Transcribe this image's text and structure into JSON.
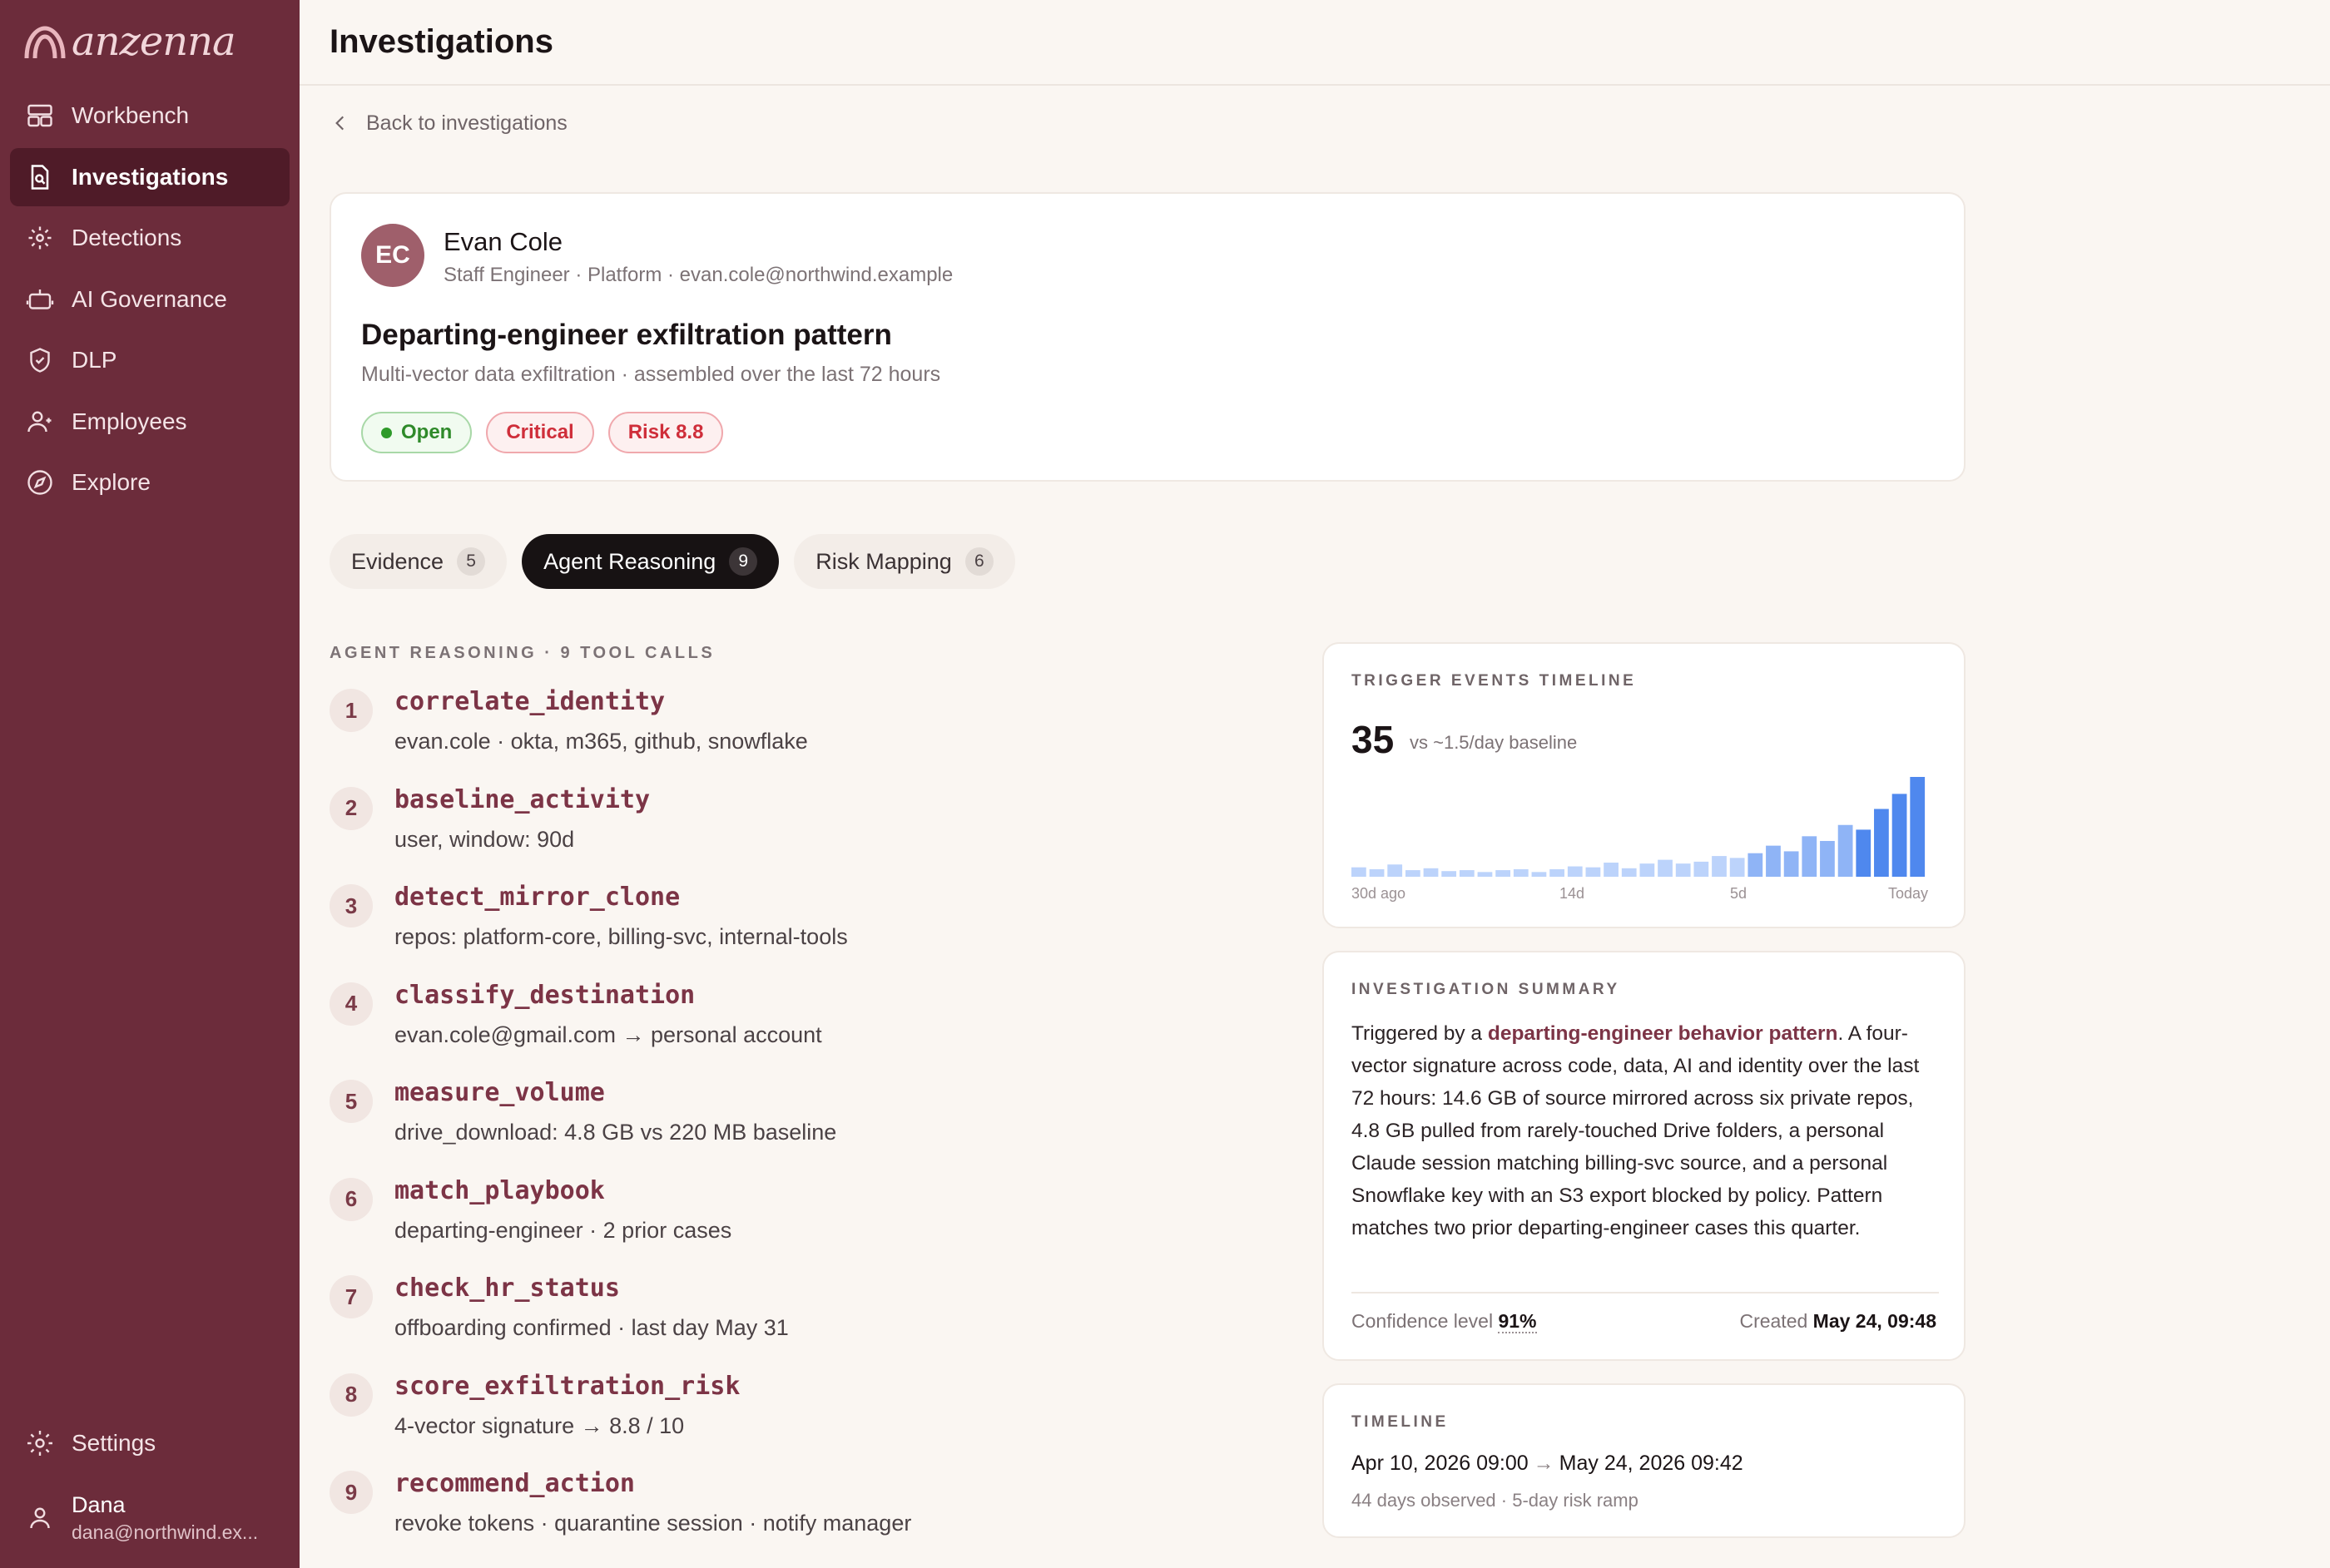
{
  "app": {
    "name": "anzenna"
  },
  "sidebar": {
    "items": [
      {
        "label": "Workbench",
        "icon": "layout-icon",
        "active": false
      },
      {
        "label": "Investigations",
        "icon": "file-search-icon",
        "active": true
      },
      {
        "label": "Detections",
        "icon": "radar-icon",
        "active": false
      },
      {
        "label": "AI Governance",
        "icon": "robot-icon",
        "active": false
      },
      {
        "label": "DLP",
        "icon": "shield-icon",
        "active": false
      },
      {
        "label": "Employees",
        "icon": "user-icon",
        "active": false
      },
      {
        "label": "Explore",
        "icon": "compass-icon",
        "active": false
      }
    ],
    "settings_label": "Settings",
    "user": {
      "name": "Dana",
      "email": "dana@northwind.ex..."
    }
  },
  "header": {
    "title": "Investigations"
  },
  "back_link": "Back to investigations",
  "case": {
    "avatar_initials": "EC",
    "person_name": "Evan Cole",
    "person_meta": "Staff Engineer · Platform · evan.cole@northwind.example",
    "title": "Departing-engineer exfiltration pattern",
    "subtitle": "Multi-vector data exfiltration · assembled over the last 72 hours",
    "badges": {
      "status": "Open",
      "severity": "Critical",
      "risk": "Risk 8.8"
    }
  },
  "tabs": [
    {
      "label": "Evidence",
      "count": "5",
      "active": false
    },
    {
      "label": "Agent Reasoning",
      "count": "9",
      "active": true
    },
    {
      "label": "Risk Mapping",
      "count": "6",
      "active": false
    }
  ],
  "reasoning": {
    "label": "AGENT REASONING · 9 TOOL CALLS",
    "steps": [
      {
        "num": "1",
        "name": "correlate_identity",
        "args": "evan.cole · okta, m365, github, snowflake"
      },
      {
        "num": "2",
        "name": "baseline_activity",
        "args": "user, window: 90d"
      },
      {
        "num": "3",
        "name": "detect_mirror_clone",
        "args": "repos: platform-core, billing-svc, internal-tools"
      },
      {
        "num": "4",
        "name": "classify_destination",
        "args": "evan.cole@gmail.com → personal account"
      },
      {
        "num": "5",
        "name": "measure_volume",
        "args": "drive_download: 4.8 GB vs 220 MB baseline"
      },
      {
        "num": "6",
        "name": "match_playbook",
        "args": "departing-engineer · 2 prior cases"
      },
      {
        "num": "7",
        "name": "check_hr_status",
        "args": "offboarding confirmed · last day May 31"
      },
      {
        "num": "8",
        "name": "score_exfiltration_risk",
        "args": "4-vector signature → 8.8 / 10"
      },
      {
        "num": "9",
        "name": "recommend_action",
        "args": "revoke tokens · quarantine session · notify manager"
      }
    ]
  },
  "trigger": {
    "label": "TRIGGER EVENTS TIMELINE",
    "count": "35",
    "baseline": "vs ~1.5/day baseline",
    "axis_labels": [
      "30d ago",
      "14d",
      "5d",
      "Today"
    ],
    "colors": {
      "normal": "#bcd3fb",
      "elevated": "#8fb4f6",
      "peak": "#4f88ee"
    }
  },
  "chart_data": {
    "type": "bar",
    "title": "TRIGGER EVENTS TIMELINE",
    "x_labels": [
      "30d ago",
      "14d",
      "5d",
      "Today"
    ],
    "values": [
      1,
      0.8,
      1.3,
      0.7,
      0.9,
      0.6,
      0.7,
      0.5,
      0.7,
      0.8,
      0.5,
      0.8,
      1.1,
      1.0,
      1.5,
      0.9,
      1.4,
      1.8,
      1.4,
      1.6,
      2.2,
      2.0,
      2.5,
      3.3,
      2.7,
      4.3,
      3.8,
      5.5,
      5.0,
      7.2,
      8.8,
      10.6
    ],
    "ylim": [
      0,
      10.6
    ],
    "grid": false,
    "legend": "none"
  },
  "summary": {
    "label": "INVESTIGATION SUMMARY",
    "text_before": "Triggered by a ",
    "highlight": "departing-engineer behavior pattern",
    "text_after": ". A four-vector signature across code, data, AI and identity over the last 72 hours: 14.6 GB of source mirrored across six private repos, 4.8 GB pulled from rarely-touched Drive folders, a personal Claude session matching billing-svc source, and a personal Snowflake key with an S3 export blocked by policy. Pattern matches two prior departing-engineer cases this quarter.",
    "confidence_label": "Confidence level",
    "confidence_value": "91%",
    "created_label": "Created",
    "created_value": "May 24, 09:48"
  },
  "timeline": {
    "label": "TIMELINE",
    "start": "Apr 10, 2026 09:00",
    "end": "May 24, 2026 09:42",
    "meta": "44 days observed · 5-day risk ramp"
  }
}
